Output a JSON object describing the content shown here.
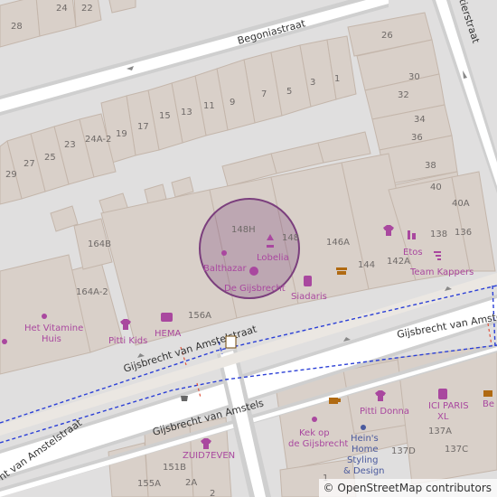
{
  "map": {
    "streets": {
      "begoniastraat": "Begoniastraat",
      "tierstraat": "tierstraat",
      "gijsbrecht_main": "Gijsbrecht van Amstelstraat",
      "gijsbrecht_right": "Gijsbrecht van Amste",
      "gijsbrecht_lower": "Gijsbrecht van Amstels",
      "gijsbrecht_left": "ht van Amstelstraat"
    },
    "house_numbers": {
      "n28": "28",
      "n24": "24",
      "n22": "22",
      "n26": "26",
      "n30": "30",
      "n32": "32",
      "n34": "34",
      "n36": "36",
      "n38": "38",
      "n40": "40",
      "n40a": "40A",
      "n136": "136",
      "n138": "138",
      "n142a": "142A",
      "n144": "144",
      "n146a": "146A",
      "n148": "148",
      "n148h": "148H",
      "n156a": "156A",
      "n164a2": "164A-2",
      "n164b": "164B",
      "n7": "7",
      "n5": "5",
      "n3": "3",
      "n1": "1",
      "n9": "9",
      "n11": "11",
      "n13": "13",
      "n15": "15",
      "n17": "17",
      "n19": "19",
      "n23": "23",
      "n24a2": "24A-2",
      "n25": "25",
      "n27": "27",
      "n29": "29",
      "n137a": "137A",
      "n137c": "137C",
      "n137d": "137D",
      "n151b": "151B",
      "n155a": "155A",
      "n2a": "2A",
      "n2": "2",
      "n1b": "1"
    },
    "pois": {
      "balthazar": "Balthazar",
      "lobelia": "Lobelia",
      "de_gijsbrecht": "De Gijsbrecht",
      "siadaris": "Siadaris",
      "etos": "Etos",
      "team_kappers": "Team Kappers",
      "hema": "HEMA",
      "pitti_kids": "Pitti Kids",
      "het_vitamine_huis_1": "Het Vitamine",
      "het_vitamine_huis_2": "Huis",
      "pitti_donna": "Pitti Donna",
      "ici_paris_1": "ICI PARIS",
      "ici_paris_2": "XL",
      "kek_1": "Kek op",
      "kek_2": "de Gijsbrecht",
      "heins_1": "Hein's",
      "heins_2": "Home",
      "heins_3": "Styling",
      "heins_4": "& Design",
      "zuid7even": "ZUID7EVEN",
      "be_partial": "Be"
    },
    "colors": {
      "background": "#e0dfdf",
      "building": "#d9d0c9",
      "building_stroke": "#c4b6ab",
      "road": "#ffffff",
      "road_casing": "#cfcfcf",
      "poi": "#a9489f",
      "highlight_fill": "rgba(120,60,120,0.28)",
      "highlight_stroke": "#7b3f7d",
      "cycle_route": "#2b3fd6"
    }
  },
  "attribution": {
    "copy": "©",
    "link": "OpenStreetMap contributors"
  }
}
